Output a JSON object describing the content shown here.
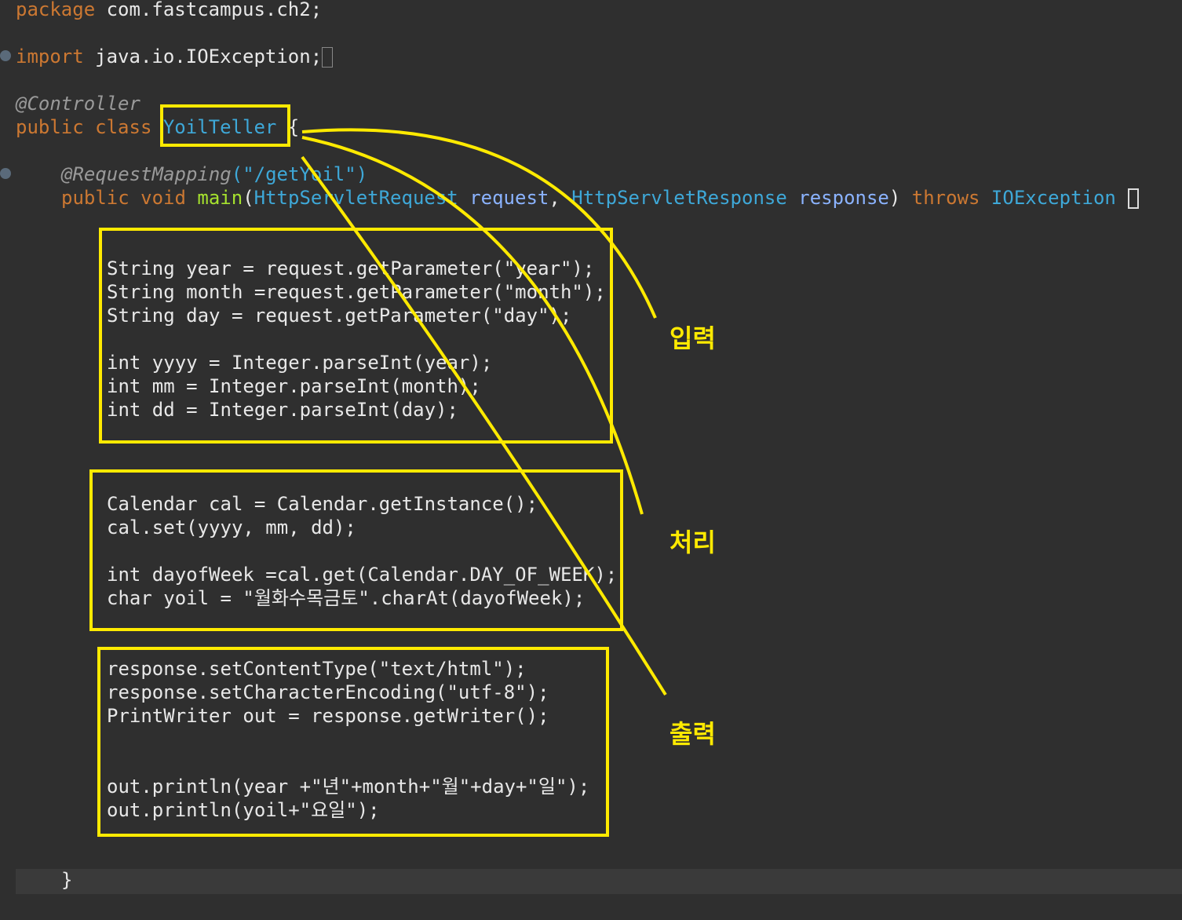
{
  "code": {
    "package_kw": "package",
    "package_name": "com.fastcampus.ch2;",
    "import_kw": "import",
    "import_name": "java.io.IOException;",
    "annotation_controller": "@Controller",
    "class_decl_kw": "public class",
    "class_name": "YoilTeller",
    "class_brace": "{",
    "mapping_annotation": "@RequestMapping",
    "mapping_path": "(\"/getYoil\")",
    "method_mods": "public void",
    "method_name": "main",
    "param1_type": "HttpServletRequest",
    "param1_name": "request",
    "param2_type": "HttpServletResponse",
    "param2_name": "response",
    "throws_kw": "throws",
    "exception_type": "IOException",
    "input_lines": [
      "String year = request.getParameter(\"year\");",
      "String month =request.getParameter(\"month\");",
      "String day = request.getParameter(\"day\");",
      "int yyyy = Integer.parseInt(year);",
      "int mm = Integer.parseInt(month);",
      "int dd = Integer.parseInt(day);"
    ],
    "process_lines": [
      "Calendar cal = Calendar.getInstance();",
      "cal.set(yyyy, mm, dd);",
      "int dayofWeek =cal.get(Calendar.DAY_OF_WEEK);",
      "char yoil = \"월화수목금토\".charAt(dayofWeek);"
    ],
    "output_lines": [
      "response.setContentType(\"text/html\");",
      "response.setCharacterEncoding(\"utf-8\");",
      "PrintWriter out = response.getWriter();",
      "out.println(year +\"년\"+month+\"월\"+day+\"일\");",
      "out.println(yoil+\"요일\");"
    ],
    "closing_brace": "}"
  },
  "labels": {
    "input": "입력",
    "process": "처리",
    "output": "출력"
  },
  "colors": {
    "highlight": "#ffea00",
    "background": "#2f2f2f"
  }
}
